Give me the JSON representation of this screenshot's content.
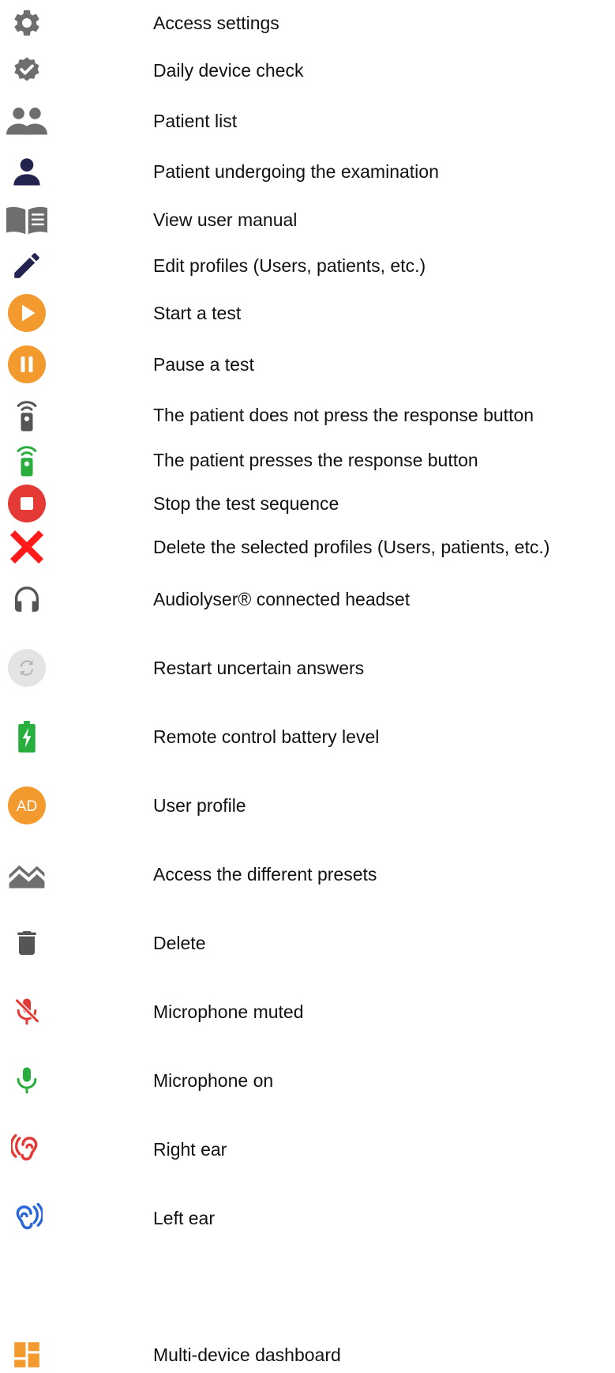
{
  "colors": {
    "gray_icon": "#6e6e6e",
    "navy_icon": "#232350",
    "orange": "#f39a2e",
    "red": "#e53935",
    "bright_red": "#ff1a1a",
    "green": "#27ae3c",
    "light_gray": "#e4e4e4",
    "blue": "#2a66d9"
  },
  "legend": {
    "items": [
      {
        "icon": "gear-icon",
        "label": "Access settings"
      },
      {
        "icon": "verified-badge-icon",
        "label": "Daily device check"
      },
      {
        "icon": "people-icon",
        "label": "Patient list"
      },
      {
        "icon": "person-icon",
        "label": "Patient undergoing the examination"
      },
      {
        "icon": "book-icon",
        "label": "View user manual"
      },
      {
        "icon": "pencil-icon",
        "label": "Edit profiles (Users, patients, etc.)"
      },
      {
        "icon": "play-icon",
        "label": "Start a test"
      },
      {
        "icon": "pause-icon",
        "label": "Pause a test"
      },
      {
        "icon": "remote-inactive-icon",
        "label": "The patient does not press the response button"
      },
      {
        "icon": "remote-active-icon",
        "label": "The patient presses the response button"
      },
      {
        "icon": "stop-icon",
        "label": "Stop the test sequence"
      },
      {
        "icon": "red-cross-icon",
        "label": "Delete the selected profiles (Users, patients, etc.)"
      },
      {
        "icon": "headphones-icon",
        "label": "Audiolyser® connected headset"
      },
      {
        "icon": "restart-icon",
        "label": "Restart uncertain answers"
      },
      {
        "icon": "battery-charging-icon",
        "label": "Remote control battery level"
      },
      {
        "icon": "avatar-icon",
        "label": "User profile",
        "avatar_text": "AD"
      },
      {
        "icon": "presets-icon",
        "label": "Access the different presets"
      },
      {
        "icon": "trash-icon",
        "label": "Delete"
      },
      {
        "icon": "mic-muted-icon",
        "label": "Microphone muted"
      },
      {
        "icon": "mic-on-icon",
        "label": "Microphone on"
      },
      {
        "icon": "right-ear-icon",
        "label": "Right ear"
      },
      {
        "icon": "left-ear-icon",
        "label": "Left ear"
      },
      {
        "icon": "dashboard-icon",
        "label": "Multi-device dashboard"
      }
    ]
  }
}
